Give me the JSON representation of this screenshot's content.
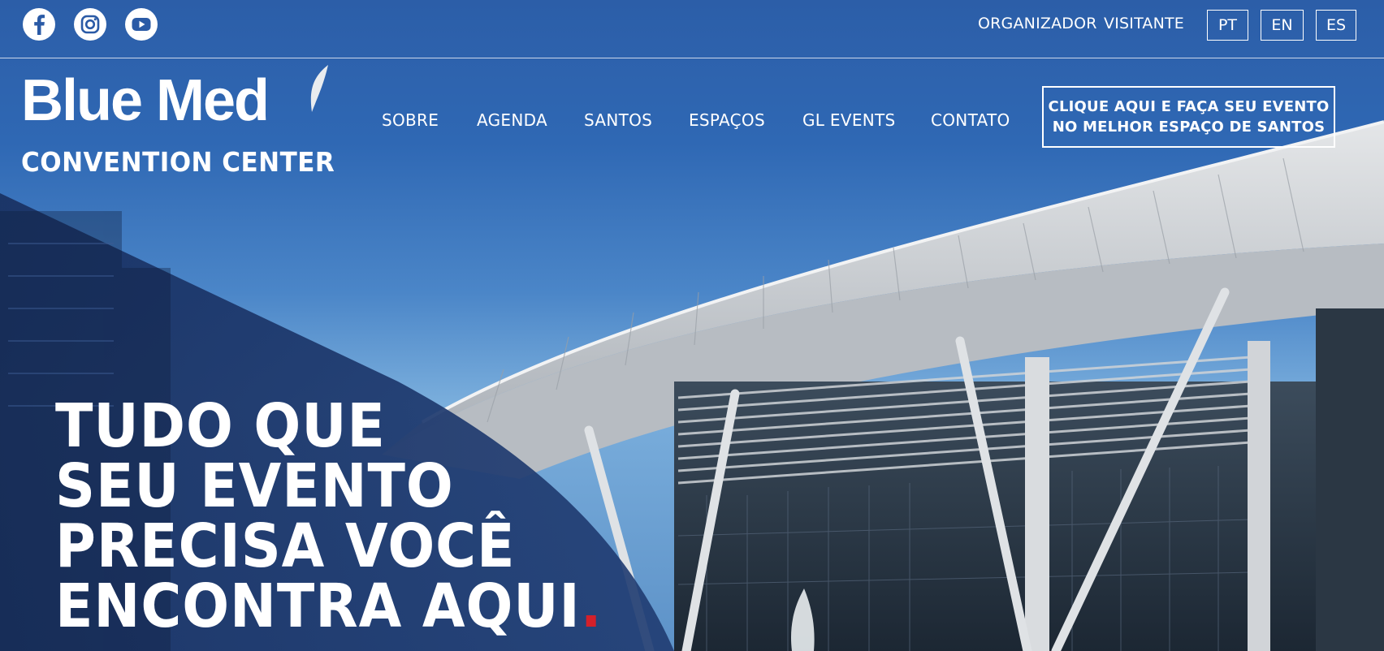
{
  "social": {
    "facebook_icon": "facebook-icon",
    "instagram_icon": "instagram-icon",
    "youtube_icon": "youtube-icon"
  },
  "topbar": {
    "organizador": "ORGANIZADOR",
    "visitante": "VISITANTE",
    "languages": [
      "PT",
      "EN",
      "ES"
    ]
  },
  "logo": {
    "main": "Blue Med",
    "sub": "CONVENTION CENTER"
  },
  "nav": {
    "items": [
      "SOBRE",
      "AGENDA",
      "SANTOS",
      "ESPAÇOS",
      "GL EVENTS",
      "CONTATO"
    ]
  },
  "cta": {
    "line1": "CLIQUE AQUI E FAÇA SEU EVENTO",
    "line2": "NO MELHOR ESPAÇO DE SANTOS"
  },
  "hero": {
    "lines": [
      "TUDO QUE",
      "SEU EVENTO",
      "PRECISA VOCÊ",
      "ENCONTRA AQUI"
    ],
    "accent": "."
  },
  "colors": {
    "sky_top": "#2c5ea8",
    "sky_light": "#7aaedc",
    "overlay_navy": "#1b3467",
    "accent_red": "#d4202a",
    "roof_grey": "#c9ced3"
  }
}
